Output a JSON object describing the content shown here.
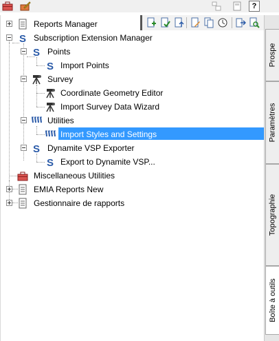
{
  "toolbar": {
    "left_icons": [
      "toolbox-icon",
      "edit-icon"
    ],
    "right_icons": [
      "window-icon",
      "document-icon",
      "help-icon"
    ],
    "help_label": "?"
  },
  "inner_toolbar": {
    "icons": [
      "new-document-icon",
      "check-document-icon",
      "refresh-document-icon",
      "edit-document-icon",
      "copy-document-icon",
      "clock-icon",
      "export-icon",
      "search-document-icon"
    ]
  },
  "tree": {
    "items": [
      {
        "label": "Reports Manager",
        "icon": "reports-icon",
        "expander": "plus"
      },
      {
        "label": "Subscription Extension Manager",
        "icon": "s-logo-icon",
        "expander": "minus"
      },
      {
        "label": "Points",
        "icon": "s-logo-icon",
        "expander": "minus"
      },
      {
        "label": "Import Points",
        "icon": "s-logo-icon"
      },
      {
        "label": "Survey",
        "icon": "survey-icon",
        "expander": "minus"
      },
      {
        "label": "Coordinate Geometry Editor",
        "icon": "survey-icon"
      },
      {
        "label": "Import Survey Data Wizard",
        "icon": "survey-icon"
      },
      {
        "label": "Utilities",
        "icon": "utilities-icon",
        "expander": "minus"
      },
      {
        "label": "Import Styles and Settings",
        "icon": "utilities-icon",
        "selected": true
      },
      {
        "label": "Dynamite VSP Exporter",
        "icon": "s-logo-icon",
        "expander": "minus"
      },
      {
        "label": "Export to Dynamite VSP...",
        "icon": "s-logo-icon"
      },
      {
        "label": "Miscellaneous Utilities",
        "icon": "toolbox-icon"
      },
      {
        "label": "EMIA Reports New",
        "icon": "reports-icon",
        "expander": "plus"
      },
      {
        "label": "Gestionnaire de rapports",
        "icon": "reports-icon",
        "expander": "plus"
      }
    ]
  },
  "tabs": [
    {
      "label": "Prospe",
      "active": false
    },
    {
      "label": "Paramètres",
      "active": false
    },
    {
      "label": "Topographie",
      "active": false
    },
    {
      "label": "Boîte à outils",
      "active": true
    }
  ],
  "colors": {
    "selection": "#3399ff",
    "s_logo": "#2a5aa8",
    "toolbox": "#c0504d"
  }
}
